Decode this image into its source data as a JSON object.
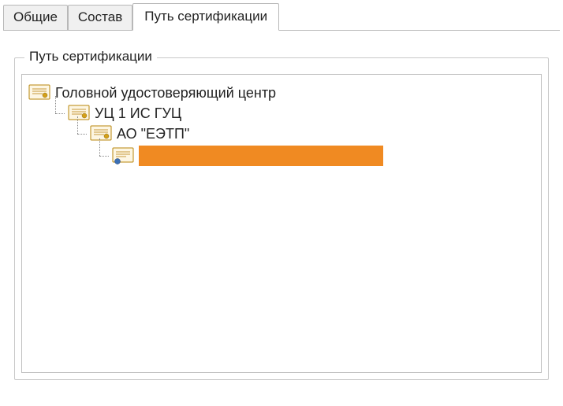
{
  "tabs": {
    "general": "Общие",
    "details": "Состав",
    "certpath": "Путь сертификации"
  },
  "fieldset": {
    "legend": "Путь сертификации"
  },
  "tree": {
    "root": "Головной удостоверяющий центр",
    "lvl1": "УЦ 1 ИС ГУЦ",
    "lvl2": "АО \"ЕЭТП\"",
    "lvl3": ""
  },
  "icons": {
    "cert": "certificate-icon"
  },
  "colors": {
    "highlight": "#f08a22",
    "tab_inactive_bg": "#f0f0f0",
    "border": "#b8b8b8"
  }
}
